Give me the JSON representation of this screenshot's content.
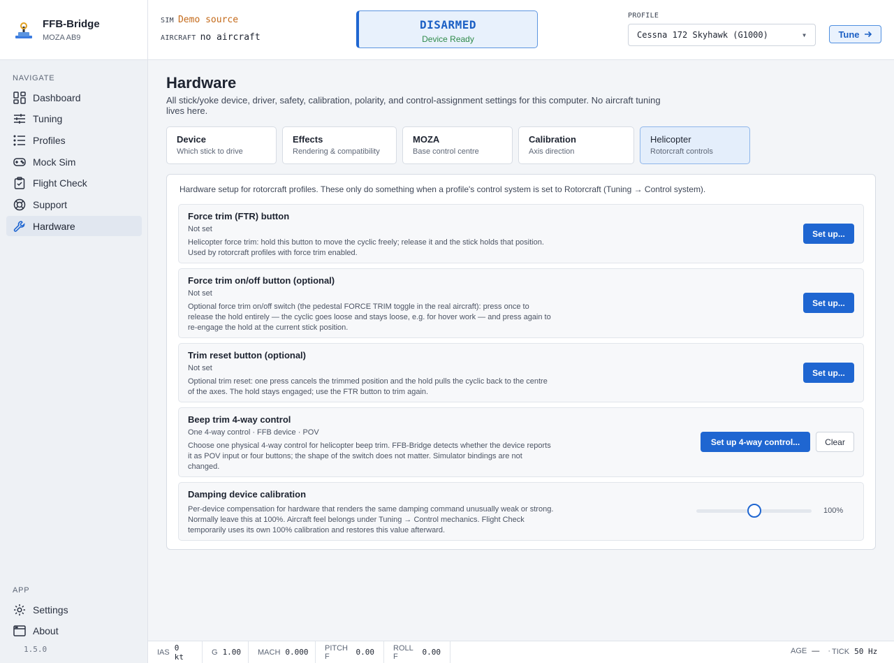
{
  "app": {
    "title": "FFB-Bridge",
    "device": "MOZA AB9",
    "version": "1.5.0"
  },
  "nav": {
    "heading": "NAVIGATE",
    "items": [
      {
        "label": "Dashboard",
        "icon": "dashboard-icon"
      },
      {
        "label": "Tuning",
        "icon": "sliders-icon"
      },
      {
        "label": "Profiles",
        "icon": "list-icon"
      },
      {
        "label": "Mock Sim",
        "icon": "gamepad-icon"
      },
      {
        "label": "Flight Check",
        "icon": "clipboard-check-icon"
      },
      {
        "label": "Support",
        "icon": "lifebuoy-icon"
      },
      {
        "label": "Hardware",
        "icon": "wrench-icon",
        "active": true
      }
    ],
    "app_heading": "APP",
    "app_items": [
      {
        "label": "Settings",
        "icon": "gear-icon"
      },
      {
        "label": "About",
        "icon": "window-icon"
      }
    ]
  },
  "topbar": {
    "sim_label": "SIM",
    "sim_value": "Demo source",
    "aircraft_label": "AIRCRAFT",
    "aircraft_value": "no aircraft",
    "arm_state": "DISARMED",
    "arm_sub": "Device Ready",
    "profile_label": "PROFILE",
    "profile_value": "Cessna 172 Skyhawk (G1000)",
    "tune_label": "Tune",
    "colors": {
      "accent": "#1f66d1",
      "sim_value": "#c46a1a",
      "ready": "#2e8a4a"
    }
  },
  "page": {
    "title": "Hardware",
    "description": "All stick/yoke device, driver, safety, calibration, polarity, and control-assignment settings for this computer. No aircraft tuning lives here.",
    "tabs": [
      {
        "title": "Device",
        "sub": "Which stick to drive"
      },
      {
        "title": "Effects",
        "sub": "Rendering & compatibility"
      },
      {
        "title": "MOZA",
        "sub": "Base control centre"
      },
      {
        "title": "Calibration",
        "sub": "Axis direction"
      },
      {
        "title": "Helicopter",
        "sub": "Rotorcraft controls",
        "active": true
      }
    ],
    "intro": "Hardware setup for rotorcraft profiles. These only do something when a profile's control system is set to Rotorcraft (Tuning → Control system).",
    "cards": [
      {
        "title": "Force trim (FTR) button",
        "status": "Not set",
        "desc": "Helicopter force trim: hold this button to move the cyclic freely; release it and the stick holds that position. Used by rotorcraft profiles with force trim enabled.",
        "button": "Set up..."
      },
      {
        "title": "Force trim on/off button (optional)",
        "status": "Not set",
        "desc": "Optional force trim on/off switch (the pedestal FORCE TRIM toggle in the real aircraft): press once to release the hold entirely — the cyclic goes loose and stays loose, e.g. for hover work — and press again to re-engage the hold at the current stick position.",
        "button": "Set up..."
      },
      {
        "title": "Trim reset button (optional)",
        "status": "Not set",
        "desc": "Optional trim reset: one press cancels the trimmed position and the hold pulls the cyclic back to the centre of the axes. The hold stays engaged; use the FTR button to trim again.",
        "button": "Set up..."
      },
      {
        "title": "Beep trim 4-way control",
        "status": "One 4-way control · FFB device · POV",
        "desc": "Choose one physical 4-way control for helicopter beep trim. FFB-Bridge detects whether the device reports it as POV input or four buttons; the shape of the switch does not matter. Simulator bindings are not changed.",
        "button": "Set up 4-way control...",
        "secondary": "Clear"
      },
      {
        "title": "Damping device calibration",
        "desc": "Per-device compensation for hardware that renders the same damping command unusually weak or strong. Normally leave this at 100%. Aircraft feel belongs under Tuning → Control mechanics. Flight Check temporarily uses its own 100% calibration and restores this value afterward.",
        "slider_value": "100%",
        "slider_fraction": 0.5
      }
    ]
  },
  "status": {
    "ias_label": "IAS",
    "ias": "0 kt",
    "g_label": "G",
    "g": "1.00",
    "mach_label": "MACH",
    "mach": "0.000",
    "pitch_label": "PITCH F",
    "pitch": "0.00",
    "roll_label": "ROLL F",
    "roll": "0.00",
    "age_label": "AGE",
    "age": "—",
    "dot": "·",
    "tick_label": "TICK",
    "tick": "50 Hz"
  }
}
